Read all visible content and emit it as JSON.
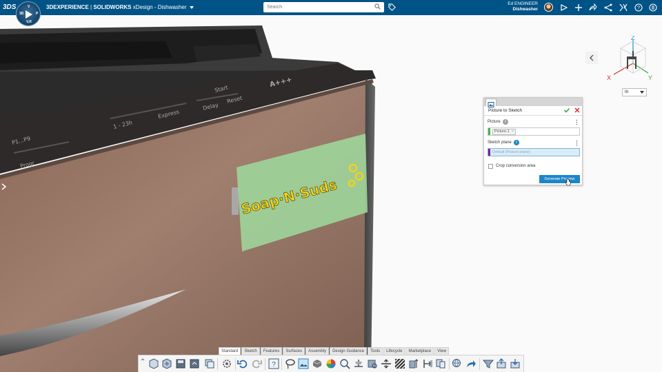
{
  "topbar": {
    "logo_text": "3DS",
    "compass": {
      "q1": "3D",
      "q2": "V",
      "q3": "V,R",
      "q4": "P"
    },
    "brand_bold": "3DEXPERIENCE",
    "brand_product": "SOLIDWORKS",
    "brand_app": "xDesign",
    "brand_separator": "-",
    "brand_model": "Dishwasher",
    "search_placeholder": "Search",
    "user_name": "Ed ENGINEER",
    "user_context": "Dishwasher"
  },
  "viewport": {
    "view_cube_labels": {
      "z": "Z",
      "x": "X",
      "y": "Y"
    },
    "units_value": "in",
    "panel_label_text": "Soap·N·Suds",
    "dishwasher_labels": {
      "p1p9": "P1...P9",
      "progr": "Progr",
      "time_a": "1 - 23h",
      "time_b": "Express",
      "delay": "Delay",
      "reset": "Reset",
      "start": "Start",
      "brand": "A+++"
    }
  },
  "panel": {
    "title": "Picture to Sketch",
    "picture_label": "Picture",
    "picture_value": "Picture.1",
    "chip_remove": "×",
    "sketch_plane_label": "Sketch plane",
    "sketch_plane_placeholder": "Default (Picture plane)",
    "info_glyph": "i",
    "crop_label": "Crop conversion area",
    "crop_checked": false,
    "generate_button": "Generate Preview"
  },
  "toolbar": {
    "tabs": [
      {
        "label": "Standard",
        "active": true
      },
      {
        "label": "Sketch",
        "active": false
      },
      {
        "label": "Features",
        "active": false
      },
      {
        "label": "Surfaces",
        "active": false
      },
      {
        "label": "Assembly",
        "active": false
      },
      {
        "label": "Design Guidance",
        "active": false
      },
      {
        "label": "Tools",
        "active": false
      },
      {
        "label": "Lifecycle",
        "active": false
      },
      {
        "label": "Marketplace",
        "active": false
      },
      {
        "label": "View",
        "active": false
      }
    ]
  },
  "colors": {
    "topbar": "#005386",
    "accent": "#1e85c9",
    "check": "#3aa346",
    "cancel": "#d32f2f",
    "picture_bar": "#4caf50",
    "plane_bar": "#7b1fa2",
    "logo_text": "#f2d21a"
  },
  "icons": [
    "search-icon",
    "tag-icon",
    "avatar",
    "share-icon",
    "add-icon",
    "network-icon",
    "tools-icon",
    "help-icon",
    "apps-icon"
  ]
}
